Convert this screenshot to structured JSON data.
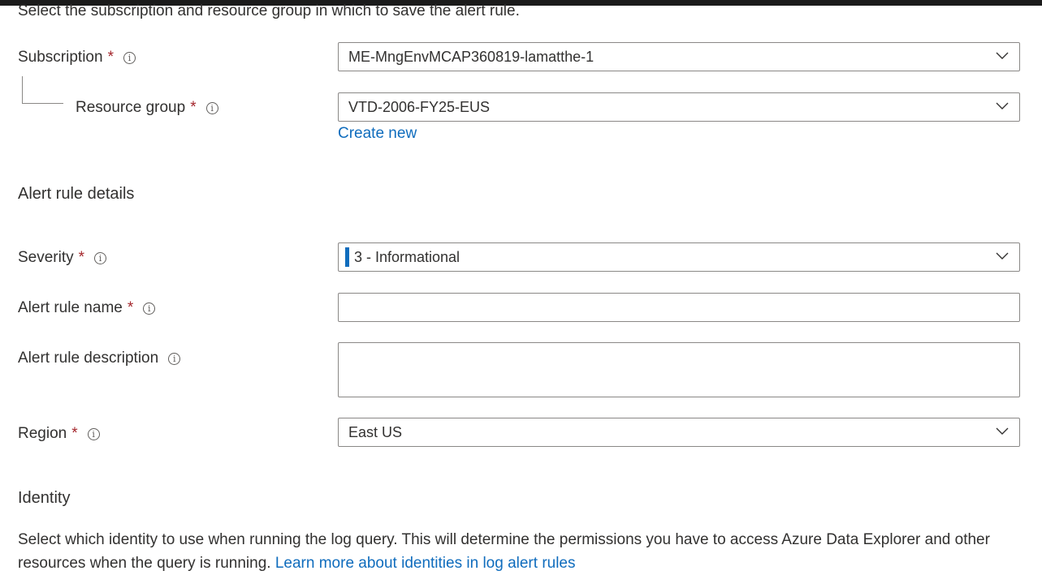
{
  "intro_text": "Select the subscription and resource group in which to save the alert rule.",
  "subscription": {
    "label": "Subscription",
    "required_mark": "*",
    "value": "ME-MngEnvMCAP360819-lamatthe-1"
  },
  "resource_group": {
    "label": "Resource group",
    "required_mark": "*",
    "value": "VTD-2006-FY25-EUS",
    "create_new": "Create new"
  },
  "alert_rule_details": {
    "heading": "Alert rule details",
    "severity": {
      "label": "Severity",
      "required_mark": "*",
      "value": "3 - Informational",
      "accent_color": "#0f6cbd"
    },
    "name": {
      "label": "Alert rule name",
      "required_mark": "*",
      "value": ""
    },
    "description": {
      "label": "Alert rule description",
      "value": ""
    },
    "region": {
      "label": "Region",
      "required_mark": "*",
      "value": "East US"
    }
  },
  "identity": {
    "heading": "Identity",
    "description": "Select which identity to use when running the log query. This will determine the permissions you have to access Azure Data Explorer and other resources when the query is running.",
    "learn_more": "Learn more about identities in log alert rules"
  },
  "icons": {
    "info": "info-icon",
    "dropdown": "chevron-down-icon"
  }
}
